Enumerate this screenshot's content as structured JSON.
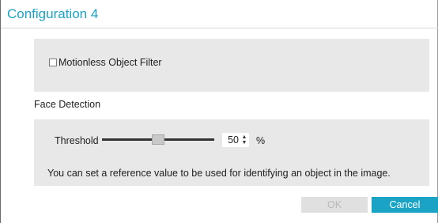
{
  "dialog": {
    "title": "Configuration 4",
    "accent_color": "#1aa3c4"
  },
  "motionless": {
    "label": "Motionless Object Filter",
    "checked": false
  },
  "face_detection": {
    "section_label": "Face Detection",
    "threshold_label": "Threshold",
    "threshold_value": "50",
    "threshold_fraction": 0.5,
    "unit": "%",
    "hint": "You can set a reference value to be used for identifying an object in the image."
  },
  "buttons": {
    "ok_label": "OK",
    "ok_enabled": false,
    "cancel_label": "Cancel"
  },
  "icons": {
    "spin_up": "▲",
    "spin_down": "▼"
  }
}
